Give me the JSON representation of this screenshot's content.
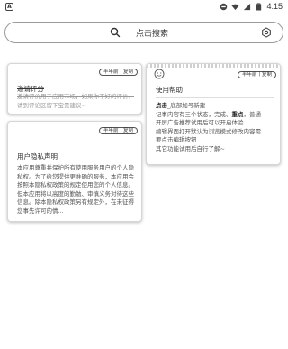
{
  "status_bar": {
    "app_badge": "A",
    "time": "4:15"
  },
  "search": {
    "label": "点击搜索"
  },
  "cards": [
    {
      "badge": "半年前丨复制",
      "title": "邀请评分",
      "body": "邀请评价用于应用市场，如果你不好的评价，请到评论区留下宝贵建议~"
    },
    {
      "badge": "半年前丨复制",
      "title": "用户隐私声明",
      "body": "本应用尊重并保护所有使用服务用户的个人隐私权。为了给您提供更准确的服务，本应用会按照本隐私权政策的规定使用您的个人信息。但本应用将以高度的勤勉、审慎义务对待这些信息。除本隐私权政策另有规定外，在未征得您事先许可的情..."
    },
    {
      "badge": "半年前丨复制",
      "title": "使用帮助",
      "body_lines": [
        {
          "segments": [
            {
              "text": "点击",
              "style": "bold"
            },
            {
              "text": "_底部加号新建",
              "style": ""
            }
          ]
        },
        {
          "segments": [
            {
              "text": "记事内容有三个状态，完成、",
              "style": ""
            },
            {
              "text": "重点",
              "style": "bold"
            },
            {
              "text": "，普通",
              "style": ""
            }
          ]
        },
        {
          "segments": [
            {
              "text": "开屏广告推荐试用后可以开启体验",
              "style": ""
            }
          ]
        },
        {
          "segments": [
            {
              "text": "编辑界面打开默认为浏览模式修改内容需",
              "style": ""
            }
          ]
        },
        {
          "segments": [
            {
              "text": "要点击编辑按钮",
              "style": ""
            }
          ]
        },
        {
          "segments": [
            {
              "text": "其它功能试用后自行了解~",
              "style": ""
            }
          ]
        }
      ]
    }
  ]
}
